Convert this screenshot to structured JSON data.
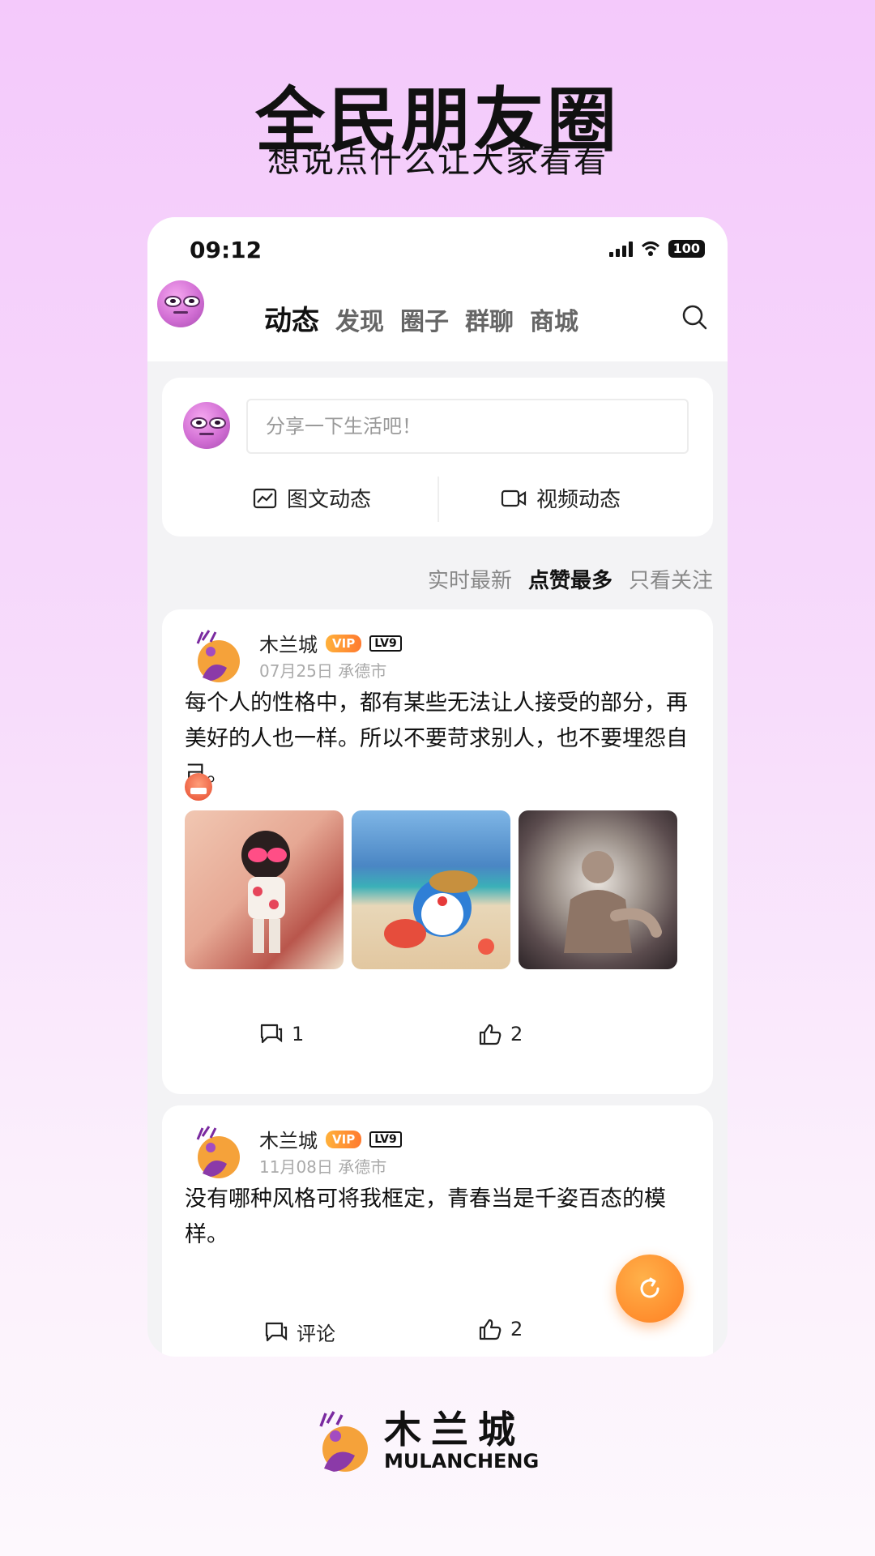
{
  "hero": {
    "title": "全民朋友圈",
    "subtitle": "想说点什么让大家看看"
  },
  "status_bar": {
    "time": "09:12",
    "battery": "100"
  },
  "nav": {
    "tabs": [
      "动态",
      "发现",
      "圈子",
      "群聊",
      "商城"
    ],
    "active": 0
  },
  "composer": {
    "placeholder": "分享一下生活吧！",
    "image_post_label": "图文动态",
    "video_post_label": "视频动态"
  },
  "filter": {
    "options": [
      "实时最新",
      "点赞最多",
      "只看关注"
    ],
    "active": 1
  },
  "posts": [
    {
      "author": "木兰城",
      "vip": "VIP",
      "level": "LV9",
      "date": "07月25日",
      "location": "承德市",
      "text": "每个人的性格中，都有某些无法让人接受的部分，再美好的人也一样。所以不要苛求别人，也不要埋怨自己。",
      "images": [
        "cartoon-boy-drink",
        "doraemon-beach",
        "buddha-statue"
      ],
      "comment_label": "1",
      "like_count": "2"
    },
    {
      "author": "木兰城",
      "vip": "VIP",
      "level": "LV9",
      "date": "11月08日",
      "location": "承德市",
      "text": "没有哪种风格可将我框定，青春当是千姿百态的模样。",
      "comment_label": "评论",
      "like_count": "2"
    }
  ],
  "brand": {
    "name": "木兰城",
    "name_en": "MULANCHENG"
  },
  "colors": {
    "accent_orange": "#ff8a2a",
    "vip_orange": "#ff9a3a",
    "background_pink": "#f4c9fb"
  }
}
